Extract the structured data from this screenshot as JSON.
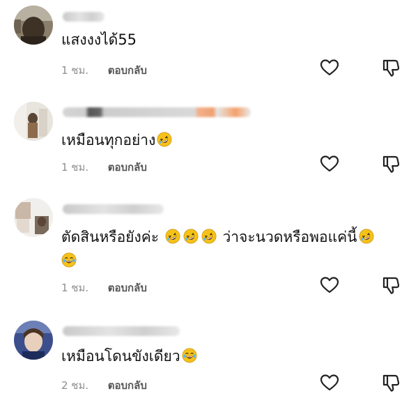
{
  "comments": [
    {
      "text": "แสงงงได้55",
      "time": "1 ชม.",
      "reply_label": "ตอบกลับ"
    },
    {
      "text": "เหมือนทุกอย่าง",
      "time": "1 ชม.",
      "reply_label": "ตอบกลับ"
    },
    {
      "text_part1": "ตัดสินหรือยังค่ะ",
      "text_part2": "ว่าจะนวดหรือพอแค่นี้",
      "time": "1 ชม.",
      "reply_label": "ตอบกลับ"
    },
    {
      "text": "เหมือนโดนขังเดียว",
      "time": "2 ชม.",
      "reply_label": "ตอบกลับ"
    }
  ],
  "icons": {
    "like": "heart-outline-icon",
    "dislike": "thumbs-down-outline-icon",
    "emoji_rofl": "rolling-on-floor-laughing-emoji",
    "emoji_joy": "face-with-tears-of-joy-emoji"
  },
  "colors": {
    "text": "#111111",
    "meta": "#8e8e8e",
    "emoji": "#f6c21a"
  }
}
